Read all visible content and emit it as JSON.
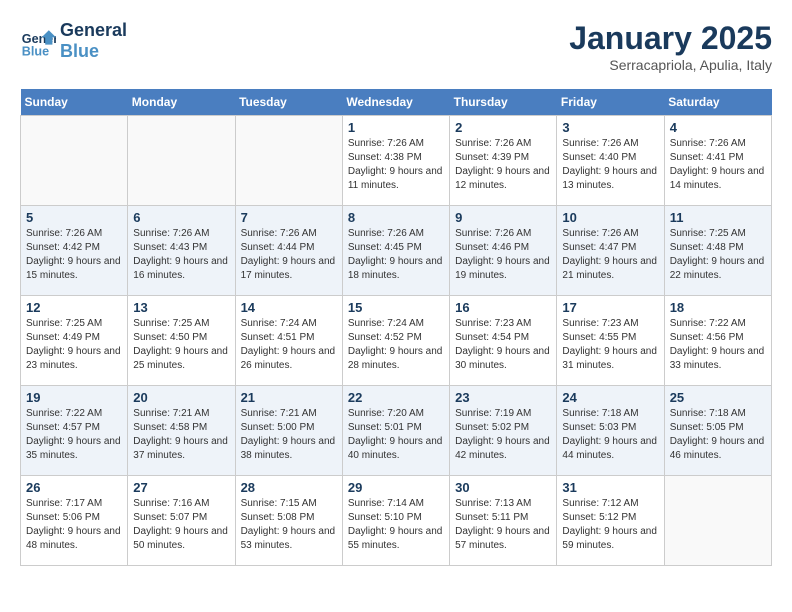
{
  "header": {
    "logo_line1": "General",
    "logo_line2": "Blue",
    "month": "January 2025",
    "location": "Serracapriola, Apulia, Italy"
  },
  "days_of_week": [
    "Sunday",
    "Monday",
    "Tuesday",
    "Wednesday",
    "Thursday",
    "Friday",
    "Saturday"
  ],
  "weeks": [
    [
      {
        "day": "",
        "info": ""
      },
      {
        "day": "",
        "info": ""
      },
      {
        "day": "",
        "info": ""
      },
      {
        "day": "1",
        "info": "Sunrise: 7:26 AM\nSunset: 4:38 PM\nDaylight: 9 hours and 11 minutes."
      },
      {
        "day": "2",
        "info": "Sunrise: 7:26 AM\nSunset: 4:39 PM\nDaylight: 9 hours and 12 minutes."
      },
      {
        "day": "3",
        "info": "Sunrise: 7:26 AM\nSunset: 4:40 PM\nDaylight: 9 hours and 13 minutes."
      },
      {
        "day": "4",
        "info": "Sunrise: 7:26 AM\nSunset: 4:41 PM\nDaylight: 9 hours and 14 minutes."
      }
    ],
    [
      {
        "day": "5",
        "info": "Sunrise: 7:26 AM\nSunset: 4:42 PM\nDaylight: 9 hours and 15 minutes."
      },
      {
        "day": "6",
        "info": "Sunrise: 7:26 AM\nSunset: 4:43 PM\nDaylight: 9 hours and 16 minutes."
      },
      {
        "day": "7",
        "info": "Sunrise: 7:26 AM\nSunset: 4:44 PM\nDaylight: 9 hours and 17 minutes."
      },
      {
        "day": "8",
        "info": "Sunrise: 7:26 AM\nSunset: 4:45 PM\nDaylight: 9 hours and 18 minutes."
      },
      {
        "day": "9",
        "info": "Sunrise: 7:26 AM\nSunset: 4:46 PM\nDaylight: 9 hours and 19 minutes."
      },
      {
        "day": "10",
        "info": "Sunrise: 7:26 AM\nSunset: 4:47 PM\nDaylight: 9 hours and 21 minutes."
      },
      {
        "day": "11",
        "info": "Sunrise: 7:25 AM\nSunset: 4:48 PM\nDaylight: 9 hours and 22 minutes."
      }
    ],
    [
      {
        "day": "12",
        "info": "Sunrise: 7:25 AM\nSunset: 4:49 PM\nDaylight: 9 hours and 23 minutes."
      },
      {
        "day": "13",
        "info": "Sunrise: 7:25 AM\nSunset: 4:50 PM\nDaylight: 9 hours and 25 minutes."
      },
      {
        "day": "14",
        "info": "Sunrise: 7:24 AM\nSunset: 4:51 PM\nDaylight: 9 hours and 26 minutes."
      },
      {
        "day": "15",
        "info": "Sunrise: 7:24 AM\nSunset: 4:52 PM\nDaylight: 9 hours and 28 minutes."
      },
      {
        "day": "16",
        "info": "Sunrise: 7:23 AM\nSunset: 4:54 PM\nDaylight: 9 hours and 30 minutes."
      },
      {
        "day": "17",
        "info": "Sunrise: 7:23 AM\nSunset: 4:55 PM\nDaylight: 9 hours and 31 minutes."
      },
      {
        "day": "18",
        "info": "Sunrise: 7:22 AM\nSunset: 4:56 PM\nDaylight: 9 hours and 33 minutes."
      }
    ],
    [
      {
        "day": "19",
        "info": "Sunrise: 7:22 AM\nSunset: 4:57 PM\nDaylight: 9 hours and 35 minutes."
      },
      {
        "day": "20",
        "info": "Sunrise: 7:21 AM\nSunset: 4:58 PM\nDaylight: 9 hours and 37 minutes."
      },
      {
        "day": "21",
        "info": "Sunrise: 7:21 AM\nSunset: 5:00 PM\nDaylight: 9 hours and 38 minutes."
      },
      {
        "day": "22",
        "info": "Sunrise: 7:20 AM\nSunset: 5:01 PM\nDaylight: 9 hours and 40 minutes."
      },
      {
        "day": "23",
        "info": "Sunrise: 7:19 AM\nSunset: 5:02 PM\nDaylight: 9 hours and 42 minutes."
      },
      {
        "day": "24",
        "info": "Sunrise: 7:18 AM\nSunset: 5:03 PM\nDaylight: 9 hours and 44 minutes."
      },
      {
        "day": "25",
        "info": "Sunrise: 7:18 AM\nSunset: 5:05 PM\nDaylight: 9 hours and 46 minutes."
      }
    ],
    [
      {
        "day": "26",
        "info": "Sunrise: 7:17 AM\nSunset: 5:06 PM\nDaylight: 9 hours and 48 minutes."
      },
      {
        "day": "27",
        "info": "Sunrise: 7:16 AM\nSunset: 5:07 PM\nDaylight: 9 hours and 50 minutes."
      },
      {
        "day": "28",
        "info": "Sunrise: 7:15 AM\nSunset: 5:08 PM\nDaylight: 9 hours and 53 minutes."
      },
      {
        "day": "29",
        "info": "Sunrise: 7:14 AM\nSunset: 5:10 PM\nDaylight: 9 hours and 55 minutes."
      },
      {
        "day": "30",
        "info": "Sunrise: 7:13 AM\nSunset: 5:11 PM\nDaylight: 9 hours and 57 minutes."
      },
      {
        "day": "31",
        "info": "Sunrise: 7:12 AM\nSunset: 5:12 PM\nDaylight: 9 hours and 59 minutes."
      },
      {
        "day": "",
        "info": ""
      }
    ]
  ]
}
